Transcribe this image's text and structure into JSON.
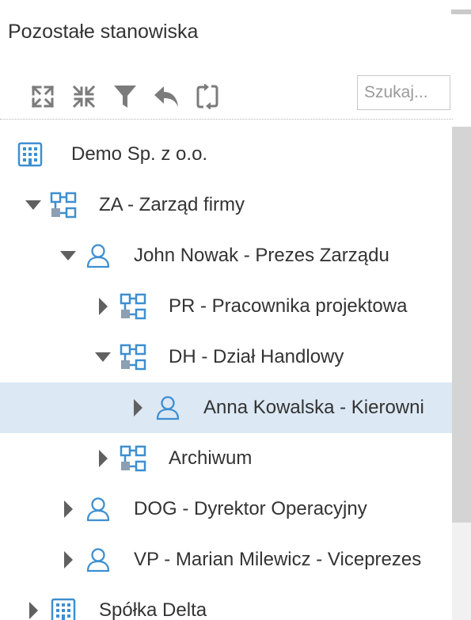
{
  "panel": {
    "title": "Pozostałe stanowiska"
  },
  "toolbar": {
    "buttons": [
      {
        "icon": "expand-all-icon"
      },
      {
        "icon": "collapse-all-icon"
      },
      {
        "icon": "filter-icon"
      },
      {
        "icon": "undo-icon"
      },
      {
        "icon": "sync-icon"
      }
    ]
  },
  "search": {
    "placeholder": "Szukaj..."
  },
  "colors": {
    "icon_blue": "#3d8fd1",
    "icon_gray": "#7b7b7b",
    "toggle": "#606060",
    "selected_row": "#dce8f3",
    "text": "#333333"
  },
  "tree": {
    "rows": [
      {
        "level": 0,
        "toggle": "none",
        "icon": "building-icon",
        "label": "Demo Sp. z o.o.",
        "selected": false
      },
      {
        "level": 0,
        "toggle": "expanded",
        "icon": "org-unit-icon",
        "label": "ZA - Zarząd firmy",
        "selected": false
      },
      {
        "level": 1,
        "toggle": "expanded",
        "icon": "person-icon",
        "label": "John Nowak - Prezes Zarządu",
        "selected": false
      },
      {
        "level": 2,
        "toggle": "collapsed",
        "icon": "org-unit-icon",
        "label": "PR - Pracownika projektowa",
        "selected": false
      },
      {
        "level": 2,
        "toggle": "expanded",
        "icon": "org-unit-icon",
        "label": "DH - Dział Handlowy",
        "selected": false
      },
      {
        "level": 3,
        "toggle": "collapsed",
        "icon": "person-icon",
        "label": "Anna Kowalska - Kierowni",
        "selected": true
      },
      {
        "level": 2,
        "toggle": "collapsed",
        "icon": "org-unit-icon",
        "label": "Archiwum",
        "selected": false
      },
      {
        "level": 1,
        "toggle": "collapsed",
        "icon": "person-icon",
        "label": "DOG - Dyrektor Operacyjny",
        "selected": false
      },
      {
        "level": 1,
        "toggle": "collapsed",
        "icon": "person-icon",
        "label": "VP - Marian Milewicz - Viceprezes",
        "selected": false
      },
      {
        "level": 0,
        "toggle": "collapsed",
        "icon": "building-icon",
        "label": "Spółka Delta",
        "selected": false
      }
    ]
  }
}
